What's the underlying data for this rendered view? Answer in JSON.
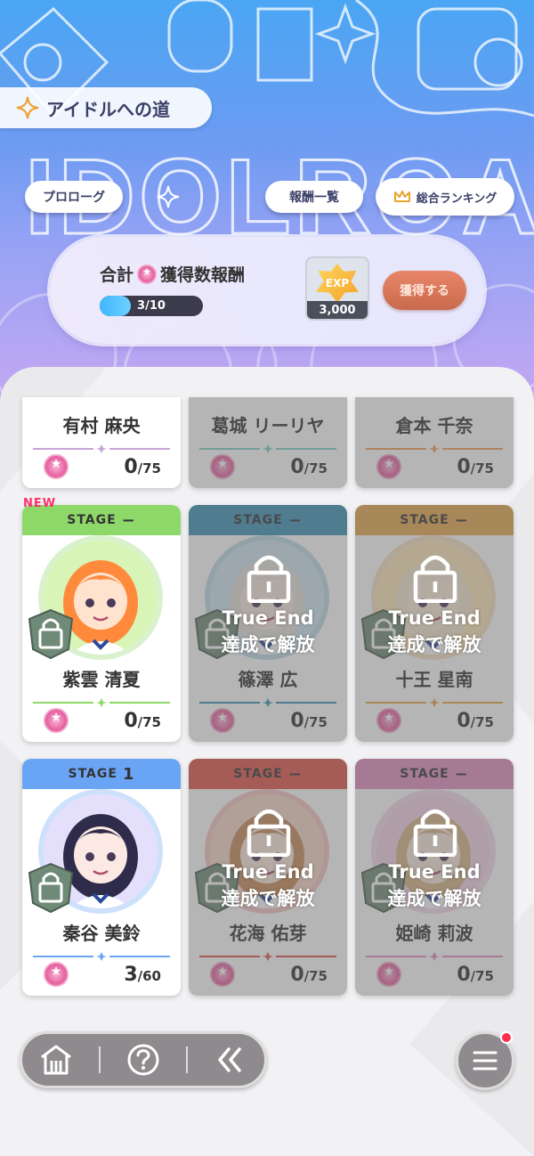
{
  "header": {
    "title": "アイドルへの道",
    "logo_text": "IDOLROAD",
    "prologue_label": "プロローグ",
    "rewards_list_label": "報酬一覧",
    "ranking_label": "総合ランキング"
  },
  "reward": {
    "title_prefix": "合計",
    "title_suffix": "獲得数報酬",
    "progress_text": "3/10",
    "progress_fraction": 0.3,
    "exp_label": "EXP",
    "exp_amount": "3,000",
    "claim_label": "獲得する"
  },
  "cards_top_partial": [
    {
      "name": "有村 麻央",
      "count": "0",
      "total": "/75",
      "locked": false,
      "accent": "#c7a4d6"
    },
    {
      "name": "葛城 リーリヤ",
      "count": "0",
      "total": "/75",
      "locked": true,
      "accent": "#7fcfc3"
    },
    {
      "name": "倉本 千奈",
      "count": "0",
      "total": "/75",
      "locked": true,
      "accent": "#f0a35a"
    }
  ],
  "cards_row2": [
    {
      "stage_label": "STAGE",
      "stage_value": "−",
      "name": "紫雲 清夏",
      "count": "0",
      "total": "/75",
      "locked": false,
      "bar_color": "#8ed86a",
      "accent": "#8ed86a",
      "is_new": true
    },
    {
      "stage_label": "STAGE",
      "stage_value": "−",
      "name": "篠澤 広",
      "count": "0",
      "total": "/75",
      "locked": true,
      "bar_color": "#3f93b8",
      "accent": "#3f93b8"
    },
    {
      "stage_label": "STAGE",
      "stage_value": "−",
      "name": "十王 星南",
      "count": "0",
      "total": "/75",
      "locked": true,
      "bar_color": "#e7a84e",
      "accent": "#e7a84e"
    }
  ],
  "cards_row3": [
    {
      "stage_label": "STAGE",
      "stage_value": "1",
      "name": "秦谷 美鈴",
      "count": "3",
      "total": "/60",
      "locked": false,
      "bar_color": "#6aa5f5",
      "accent": "#6aa5f5"
    },
    {
      "stage_label": "STAGE",
      "stage_value": "−",
      "name": "花海 佑芽",
      "count": "0",
      "total": "/75",
      "locked": true,
      "bar_color": "#e0554c",
      "accent": "#e0554c"
    },
    {
      "stage_label": "STAGE",
      "stage_value": "−",
      "name": "姫崎 莉波",
      "count": "0",
      "total": "/75",
      "locked": true,
      "bar_color": "#e38fc0",
      "accent": "#e38fc0"
    }
  ],
  "lock_text": {
    "line1": "True End",
    "line2": "達成で解放"
  },
  "new_label": "NEW",
  "nav": {
    "icons": [
      "home-icon",
      "help-icon",
      "back-icon"
    ],
    "menu_icon": "menu-icon",
    "has_notification": true
  }
}
